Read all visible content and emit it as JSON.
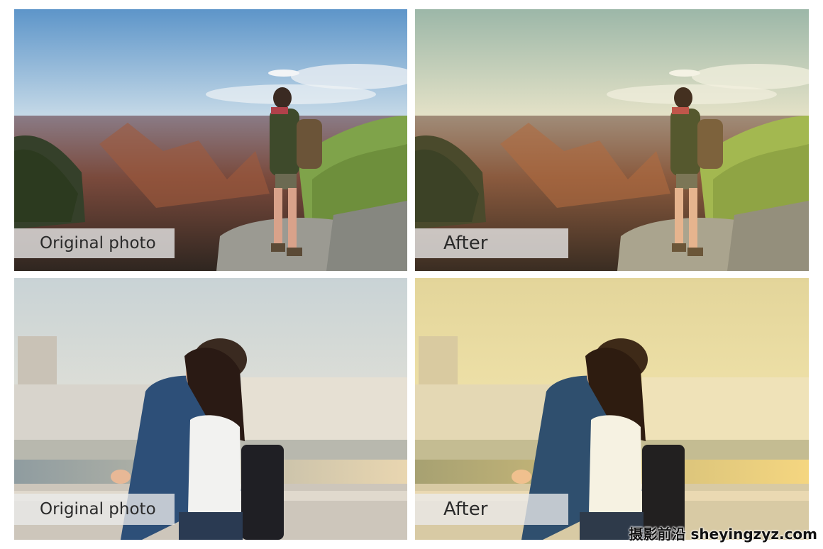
{
  "panels": [
    {
      "label": "Original photo"
    },
    {
      "label": "After"
    },
    {
      "label": "Original photo"
    },
    {
      "label": "After"
    }
  ],
  "watermark": "摄影前沿 sheyingzyz.com"
}
